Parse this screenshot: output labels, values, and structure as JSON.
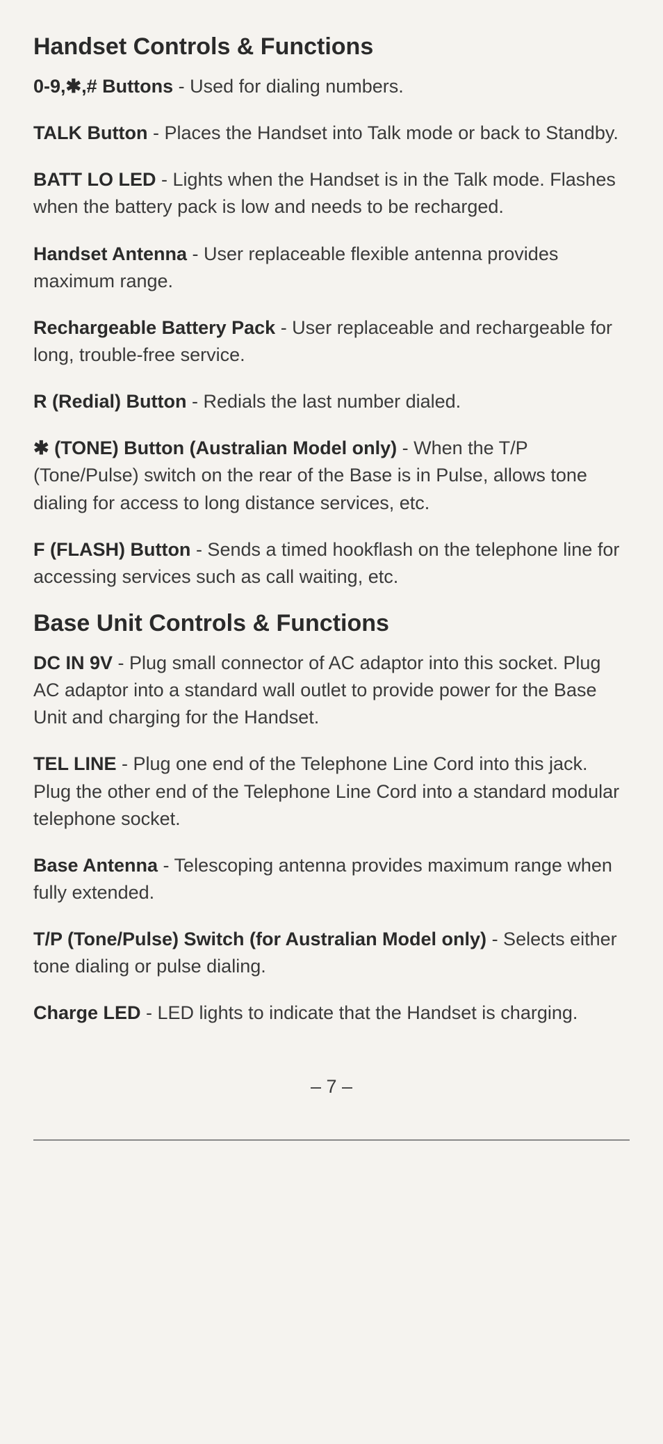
{
  "sections": {
    "handset": {
      "title": "Handset Controls & Functions",
      "entries": [
        {
          "term": "0-9,✱,# Buttons",
          "desc": " - Used for dialing numbers."
        },
        {
          "term": "TALK Button",
          "desc": " - Places the Handset into Talk mode or back to Standby."
        },
        {
          "term": "BATT LO LED",
          "desc": " - Lights when the Handset is in the Talk mode. Flashes when the battery pack is low and needs to be recharged."
        },
        {
          "term": "Handset Antenna",
          "desc": " - User replaceable flexible antenna provides maximum range."
        },
        {
          "term": "Rechargeable Battery Pack",
          "desc": " - User replaceable and rechargeable for long, trouble-free service."
        },
        {
          "term": "R (Redial) Button",
          "desc": " - Redials the last number dialed."
        },
        {
          "term": "✱  (TONE) Button (Australian Model only)",
          "desc": " - When the T/P (Tone/Pulse) switch on the rear of the Base is in Pulse, allows tone dialing for access to long distance services, etc."
        },
        {
          "term": "F (FLASH) Button",
          "desc": " - Sends a timed hookflash on the telephone line for accessing services such as call waiting, etc."
        }
      ]
    },
    "base": {
      "title": "Base Unit Controls & Functions",
      "entries": [
        {
          "term": "DC IN 9V",
          "desc": " - Plug small connector of AC adaptor into this socket. Plug AC adaptor into a standard wall outlet to provide power for the Base Unit and charging for the Handset."
        },
        {
          "term": "TEL LINE",
          "desc": " - Plug one end of the Telephone Line Cord into this jack. Plug the other end of the Telephone Line Cord into a standard modular telephone socket."
        },
        {
          "term": "Base Antenna",
          "desc": " - Telescoping antenna provides maximum range when fully extended."
        },
        {
          "term": "T/P (Tone/Pulse) Switch (for Australian Model only)",
          "desc": " - Selects either tone dialing or pulse dialing."
        },
        {
          "term": "Charge LED",
          "desc": " - LED lights to indicate that the Handset is charging."
        }
      ]
    }
  },
  "page_number": "– 7 –"
}
